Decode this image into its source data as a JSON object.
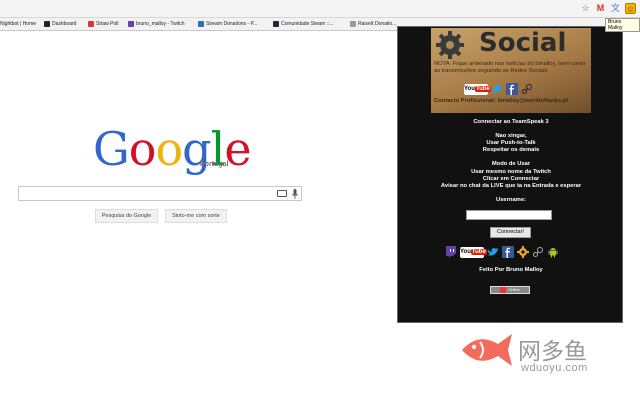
{
  "bookmarks": [
    {
      "label": "Nightbot | Home",
      "color": "#555555"
    },
    {
      "label": "Dashboard",
      "color": "#222222"
    },
    {
      "label": "Straw Poll",
      "color": "#d43a3a"
    },
    {
      "label": "bruno_malloy - Twitch",
      "color": "#6441a5"
    },
    {
      "label": "Stream Donations - P...",
      "color": "#2a6fb0"
    },
    {
      "label": "Comunidade Steam ::...",
      "color": "#1b2838"
    },
    {
      "label": "RaiseIt Donatio...",
      "color": "#999999"
    }
  ],
  "toolbar": {
    "ext_icons": [
      "star-icon",
      "gmail-icon",
      "translate-icon",
      "teamspeak-extension-icon"
    ],
    "tooltip": "Bruno Malloy"
  },
  "google": {
    "logo": {
      "G": "G",
      "o1": "o",
      "o2": "o",
      "g": "g",
      "l": "l",
      "e": "e"
    },
    "region": "Portugal",
    "search_button": "Pesquisa do Google",
    "lucky_button": "Sinto-me com sorte"
  },
  "popup": {
    "banner_title": "Social",
    "banner_nota": "NOTA: Fique antenado nas notícias do bmalloy, bem como as transmissões seguindo as Redes Sociais",
    "banner_contact": "Contacto Profissional: bmalloy@worldoftanks.pt",
    "connect_title": "Connectar ao TeamSpeak 3",
    "rules": [
      "Nao xingar,",
      "Usar Push-to-Talk",
      "Respeitar os demais"
    ],
    "mode_lines": [
      "Modo de Usar",
      "Usar mesmo nome da Twitch",
      "Clicar em Connectar",
      "Avisar no chat da LIVE que ta na Entrada e esperar"
    ],
    "username_label": "Username:",
    "connect_button": "Connectar!",
    "footer": "Feito Por Bruno Malloy",
    "counter_text": "Online"
  },
  "watermark": {
    "cn": "网多鱼",
    "url": "wduoyu.com"
  }
}
